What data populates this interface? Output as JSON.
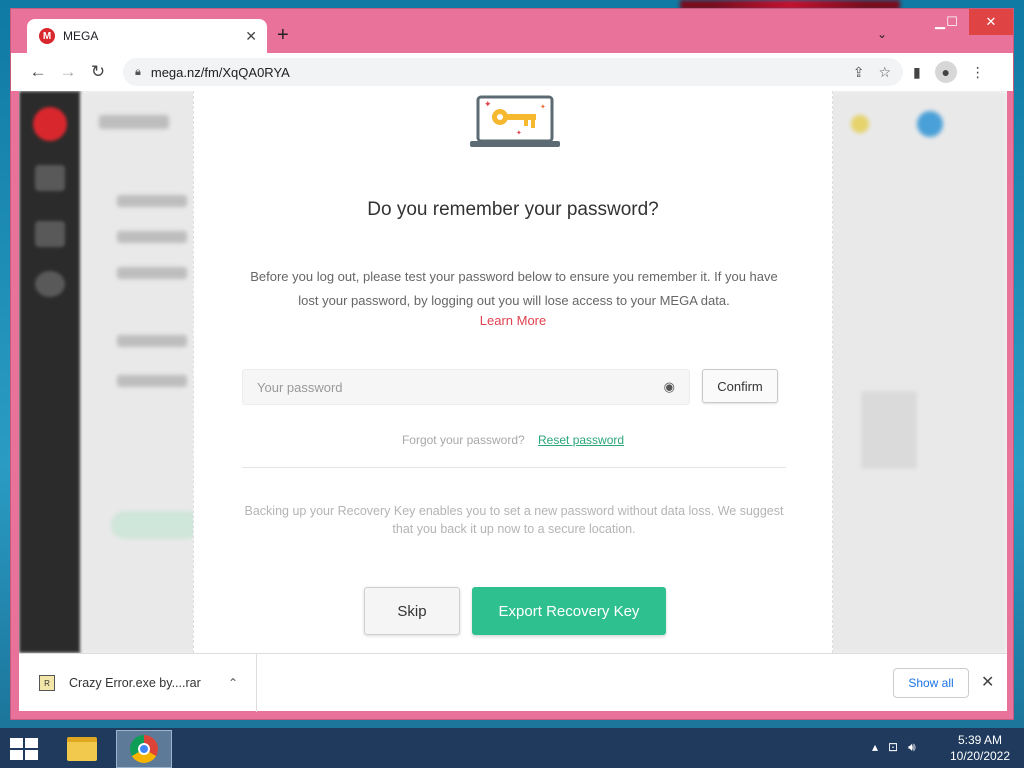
{
  "browser": {
    "tab_title": "MEGA",
    "tab_favicon_letter": "M",
    "url": "mega.nz/fm/XqQA0RYA",
    "icons": [
      "back-icon",
      "forward-icon",
      "reload-icon",
      "lock-icon",
      "share-icon",
      "star-icon",
      "sidebar-icon",
      "profile-icon",
      "menu-icon"
    ]
  },
  "modal": {
    "title": "Do you remember your password?",
    "description": "Before you log out, please test your password below to ensure you remember it. If you have lost your password, by logging out you will lose access to your MEGA data.",
    "learn_more": "Learn More",
    "password_placeholder": "Your password",
    "confirm_label": "Confirm",
    "forgot_text": "Forgot your password?",
    "reset_link": "Reset password",
    "backup_text": "Backing up your Recovery Key enables you to set a new password without data loss. We suggest that you back it up now to a secure location.",
    "skip_label": "Skip",
    "export_label": "Export Recovery Key",
    "accent_color": "#2fc08f"
  },
  "downloads": {
    "file_name": "Crazy Error.exe by....rar",
    "show_all": "Show all"
  },
  "taskbar": {
    "time": "5:39 AM",
    "date": "10/20/2022"
  }
}
